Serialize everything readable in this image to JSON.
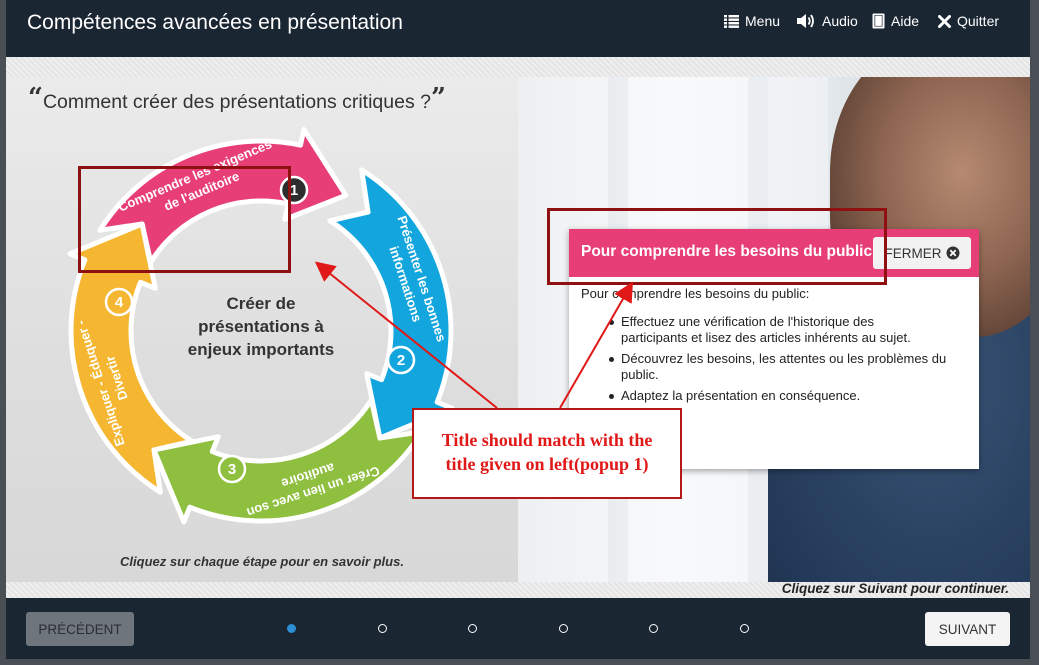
{
  "header": {
    "title": "Compétences avancées en présentation",
    "nav": {
      "menu": "Menu",
      "audio": "Audio",
      "help": "Aide",
      "quit": "Quitter"
    }
  },
  "left": {
    "question": "Comment créer des présentations critiques ?",
    "hint": "Cliquez sur chaque étape pour en savoir plus.",
    "center_text": [
      "Créer de",
      "présentations à",
      "enjeux importants"
    ],
    "steps": [
      {
        "number": "1",
        "color": "#e83e77",
        "lines": [
          "Comprendre les exigences",
          "de l'auditoire"
        ]
      },
      {
        "number": "2",
        "color": "#13a6de",
        "lines": [
          "Présenter les bonnes",
          "informations"
        ]
      },
      {
        "number": "3",
        "color": "#8fbf3f",
        "lines": [
          "Créer un lien avec son",
          "auditoire"
        ]
      },
      {
        "number": "4",
        "color": "#f5b731",
        "lines": [
          "Expliquer - Éduquer -",
          "Divertir"
        ]
      }
    ]
  },
  "right": {
    "hint": "Cliquez sur Suivant pour continuer."
  },
  "popup": {
    "title": "Pour comprendre les besoins du public",
    "close_label": "FERMER",
    "intro": "Pour comprendre les besoins du public:",
    "bullets": [
      [
        "Effectuez une vérification de l'historique des",
        "participants et lisez des articles inhérents au sujet."
      ],
      [
        "Découvrez les besoins, les attentes ou les problèmes du",
        "public."
      ],
      [
        "Adaptez la présentation en conséquence."
      ]
    ]
  },
  "annotation": {
    "callout_lines": [
      "Title should match with the",
      "title given on left(popup 1)"
    ],
    "color": "#e01818"
  },
  "footer": {
    "prev_label": "PRÉCÉDENT",
    "next_label": "SUIVANT",
    "progress": {
      "current": 1,
      "total": 6
    }
  }
}
